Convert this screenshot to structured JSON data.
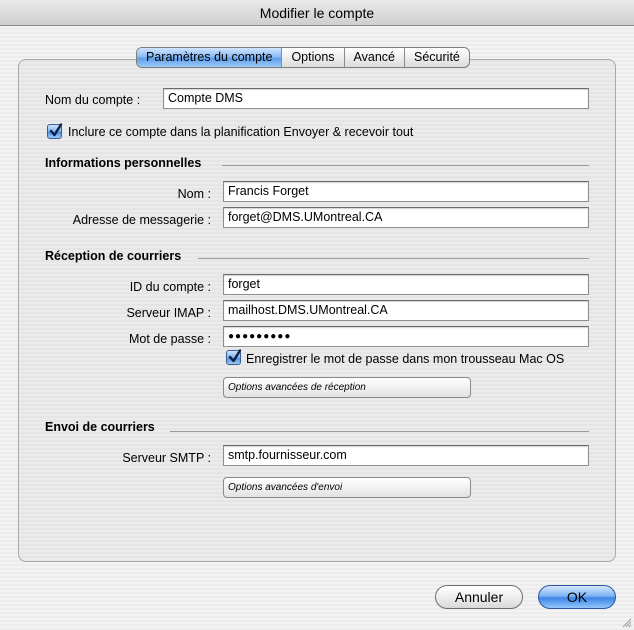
{
  "window": {
    "title": "Modifier le compte"
  },
  "tabs": [
    {
      "label": "Paramètres du compte",
      "active": true
    },
    {
      "label": "Options",
      "active": false
    },
    {
      "label": "Avancé",
      "active": false
    },
    {
      "label": "Sécurité",
      "active": false
    }
  ],
  "account": {
    "name_label": "Nom du compte :",
    "name_value": "Compte DMS",
    "include_checkbox_label": "Inclure ce compte dans la planification Envoyer & recevoir tout",
    "include_checked": true
  },
  "personal": {
    "heading": "Informations personnelles",
    "name_label": "Nom :",
    "name_value": "Francis Forget",
    "email_label": "Adresse de messagerie :",
    "email_value": "forget@DMS.UMontreal.CA"
  },
  "incoming": {
    "heading": "Réception de courriers",
    "account_id_label": "ID du compte :",
    "account_id_value": "forget",
    "imap_label": "Serveur IMAP :",
    "imap_value": "mailhost.DMS.UMontreal.CA",
    "password_label": "Mot de passe :",
    "password_value": "●●●●●●●●●",
    "keychain_label": "Enregistrer le mot de passe dans mon trousseau Mac OS",
    "keychain_checked": true,
    "advanced_button": "Options avancées de réception"
  },
  "outgoing": {
    "heading": "Envoi de courriers",
    "smtp_label": "Serveur SMTP :",
    "smtp_value": "smtp.fournisseur.com",
    "advanced_button": "Options avancées d'envoi"
  },
  "buttons": {
    "cancel": "Annuler",
    "ok": "OK"
  },
  "colors": {
    "accent": "#5f9ee8",
    "window_bg": "#ececec"
  }
}
